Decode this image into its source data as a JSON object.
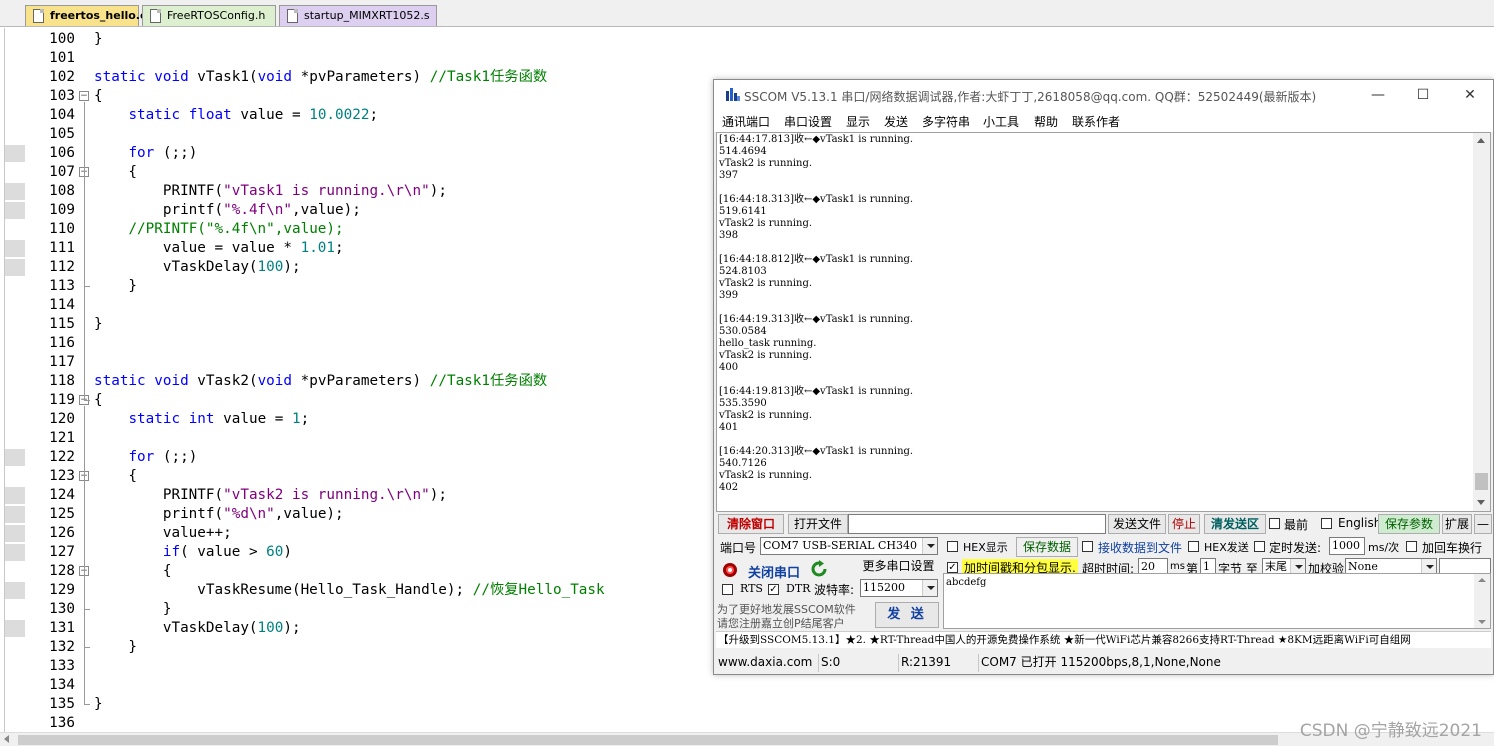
{
  "editor": {
    "tabs": [
      {
        "label": "freertos_hello.c"
      },
      {
        "label": "FreeRTOSConfig.h"
      },
      {
        "label": "startup_MIMXRT1052.s"
      }
    ],
    "lines": [
      {
        "num": "100",
        "text": "}"
      },
      {
        "num": "101",
        "text": ""
      },
      {
        "num": "102",
        "text": "static void vTask1(void *pvParameters) //Task1任务函数"
      },
      {
        "num": "103",
        "text": "{"
      },
      {
        "num": "104",
        "text": "    static float value = 10.0022;"
      },
      {
        "num": "105",
        "text": ""
      },
      {
        "num": "106",
        "text": "    for (;;)"
      },
      {
        "num": "107",
        "text": "    {"
      },
      {
        "num": "108",
        "text": "        PRINTF(\"vTask1 is running.\\r\\n\");"
      },
      {
        "num": "109",
        "text": "        printf(\"%.4f\\n\",value);"
      },
      {
        "num": "110",
        "text": "    //PRINTF(\"%.4f\\n\",value);"
      },
      {
        "num": "111",
        "text": "        value = value * 1.01;"
      },
      {
        "num": "112",
        "text": "        vTaskDelay(100);"
      },
      {
        "num": "113",
        "text": "    }"
      },
      {
        "num": "114",
        "text": ""
      },
      {
        "num": "115",
        "text": "}"
      },
      {
        "num": "116",
        "text": ""
      },
      {
        "num": "117",
        "text": ""
      },
      {
        "num": "118",
        "text": "static void vTask2(void *pvParameters) //Task1任务函数"
      },
      {
        "num": "119",
        "text": "{"
      },
      {
        "num": "120",
        "text": "    static int value = 1;"
      },
      {
        "num": "121",
        "text": ""
      },
      {
        "num": "122",
        "text": "    for (;;)"
      },
      {
        "num": "123",
        "text": "    {"
      },
      {
        "num": "124",
        "text": "        PRINTF(\"vTask2 is running.\\r\\n\");"
      },
      {
        "num": "125",
        "text": "        printf(\"%d\\n\",value);"
      },
      {
        "num": "126",
        "text": "        value++;"
      },
      {
        "num": "127",
        "text": "        if( value > 60)"
      },
      {
        "num": "128",
        "text": "        {"
      },
      {
        "num": "129",
        "text": "            vTaskResume(Hello_Task_Handle); //恢复Hello_Task"
      },
      {
        "num": "130",
        "text": "        }"
      },
      {
        "num": "131",
        "text": "        vTaskDelay(100);"
      },
      {
        "num": "132",
        "text": "    }"
      },
      {
        "num": "133",
        "text": ""
      },
      {
        "num": "134",
        "text": ""
      },
      {
        "num": "135",
        "text": "}"
      },
      {
        "num": "136",
        "text": ""
      }
    ]
  },
  "watermark": "CSDN @宁静致远2021",
  "sscom": {
    "title": "SSCOM V5.13.1 串口/网络数据调试器,作者:大虾丁丁,2618058@qq.com. QQ群：52502449(最新版本)",
    "window_buttons": {
      "minimize": "—",
      "maximize": "☐",
      "close": "✕"
    },
    "menu": [
      "通讯端口",
      "串口设置",
      "显示",
      "发送",
      "多字符串",
      "小工具",
      "帮助",
      "联系作者"
    ],
    "receive_lines": [
      "[16:44:17.813]收←◆vTask1 is running.",
      "514.4694",
      "vTask2 is running.",
      "397",
      "",
      "[16:44:18.313]收←◆vTask1 is running.",
      "519.6141",
      "vTask2 is running.",
      "398",
      "",
      "[16:44:18.812]收←◆vTask1 is running.",
      "524.8103",
      "vTask2 is running.",
      "399",
      "",
      "[16:44:19.313]收←◆vTask1 is running.",
      "530.0584",
      "hello_task running.",
      "vTask2 is running.",
      "400",
      "",
      "[16:44:19.813]收←◆vTask1 is running.",
      "535.3590",
      "vTask2 is running.",
      "401",
      "",
      "[16:44:20.313]收←◆vTask1 is running.",
      "540.7126",
      "vTask2 is running.",
      "402"
    ],
    "buttons": {
      "clear_window": "清除窗口",
      "open_file": "打开文件",
      "send_file": "发送文件",
      "stop": "停止",
      "clear_send": "清发送区",
      "save_params": "保存参数",
      "expand": "扩展",
      "collapse": "—",
      "save_data": "保存数据",
      "more_port_settings": "更多串口设置",
      "close_port": "关闭串口",
      "send": "发 送"
    },
    "checks": {
      "topmost": "最前",
      "english": "English",
      "hex_display": "HEX显示",
      "recv_to_file": "接收数据到文件",
      "hex_send": "HEX发送",
      "timed_send": "定时发送:",
      "add_crlf": "加回车换行",
      "timestamp": "加时间戳和分包显示.",
      "rts": "RTS",
      "dtr": "DTR"
    },
    "labels": {
      "port_num": "端口号",
      "baud": "波特率:",
      "timeout": "超时时间:",
      "ms": "ms",
      "ms_per": "ms/次",
      "di": "第",
      "byte": "字节 至",
      "checksum": "加校验",
      "promo": "为了更好地发展SSCOM软件",
      "promo2": "请您注册嘉立创P结尾客户"
    },
    "values": {
      "port": "COM7 USB-SERIAL CH340",
      "baud": "115200",
      "timeout": "20",
      "byte_start": "1",
      "byte_end": "末尾",
      "checksum": "None",
      "interval": "1000",
      "send_text": "abcdefg"
    },
    "ticker": "【升级到SSCOM5.13.1】★2. ★RT-Thread中国人的开源免费操作系统 ★新一代WiFi芯片兼容8266支持RT-Thread ★8KM远距离WiFi可自组网",
    "status": {
      "site": "www.daxia.com",
      "sent": "S:0",
      "recv": "R:21391",
      "port_state": "COM7 已打开  115200bps,8,1,None,None"
    }
  }
}
